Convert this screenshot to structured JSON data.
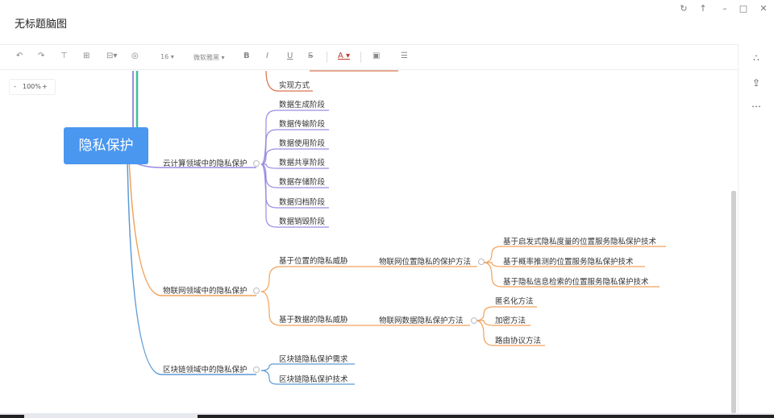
{
  "window": {
    "title": "无标题脑图",
    "controls": [
      "refresh-icon",
      "pin-icon",
      "minimize-icon",
      "maximize-icon",
      "close-icon"
    ]
  },
  "toolbar": {
    "font_size": "16",
    "font_family": "微软雅黑",
    "bold": "B",
    "italic": "I",
    "underline": "U",
    "strike": "S",
    "font_color": "A",
    "icons": [
      "undo-icon",
      "redo-icon",
      "insert-child-icon",
      "insert-sibling-icon",
      "insert-parent-icon",
      "location-icon",
      "image-icon",
      "link-icon"
    ]
  },
  "zoom": {
    "minus": "-",
    "value": "100%",
    "plus": "+"
  },
  "mindmap": {
    "root": "隐私保护",
    "branches": [
      {
        "label": "实现方式",
        "color": "#d9734f"
      },
      {
        "label": "云计算领域中的隐私保护",
        "color": "#9b8de0",
        "children": [
          "数据生成阶段",
          "数据传输阶段",
          "数据使用阶段",
          "数据共享阶段",
          "数据存储阶段",
          "数据归档阶段",
          "数据销毁阶段"
        ]
      },
      {
        "label": "物联网领域中的隐私保护",
        "color": "#f0a25a",
        "children": [
          {
            "label": "基于位置的隐私威胁",
            "method": "物联网位置隐私的保护方法",
            "children": [
              "基于启发式隐私度量的位置服务隐私保护技术",
              "基于概率推测的位置服务隐私保护技术",
              "基于隐私信息检索的位置服务隐私保护技术"
            ]
          },
          {
            "label": "基于数据的隐私威胁",
            "method": "物联网数据隐私保护方法",
            "children": [
              "匿名化方法",
              "加密方法",
              "路由协议方法"
            ]
          }
        ]
      },
      {
        "label": "区块链领域中的隐私保护",
        "color": "#5b9bd5",
        "children": [
          "区块链隐私保护需求",
          "区块链隐私保护技术"
        ]
      }
    ]
  },
  "rightbar": {
    "icons": [
      "share-icon",
      "export-icon",
      "more-icon"
    ]
  },
  "colors": {
    "root_fill": "#4a97f0",
    "teal_branch": "#3bbf9a"
  }
}
